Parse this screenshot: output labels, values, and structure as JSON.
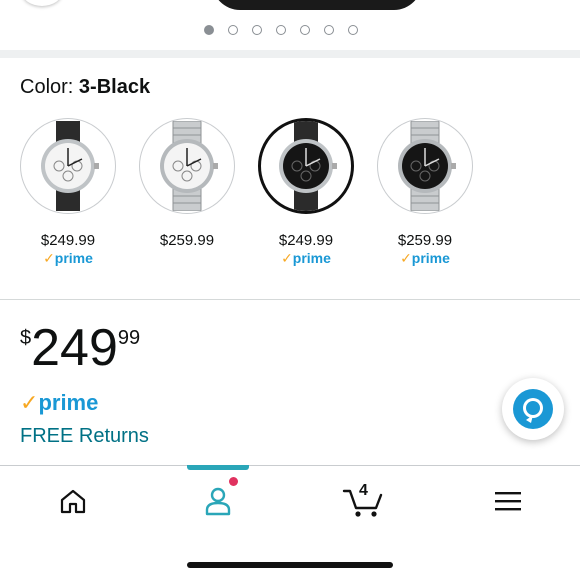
{
  "carousel": {
    "dot_count": 7,
    "active_index": 0
  },
  "color_section": {
    "label": "Color:",
    "selected": "3-Black"
  },
  "swatches": [
    {
      "price": "$249.99",
      "prime": "prime",
      "dial": "white",
      "band": "leather",
      "selected": false
    },
    {
      "price": "$259.99",
      "prime": "",
      "dial": "white",
      "band": "steel",
      "selected": false
    },
    {
      "price": "$249.99",
      "prime": "prime",
      "dial": "black",
      "band": "leather",
      "selected": true
    },
    {
      "price": "$259.99",
      "prime": "prime",
      "dial": "black",
      "band": "steel",
      "selected": false
    }
  ],
  "price": {
    "symbol": "$",
    "whole": "249",
    "fraction": "99"
  },
  "prime_badge": {
    "check": "✓",
    "text": "prime"
  },
  "free_returns": "FREE Returns",
  "nav": {
    "items": [
      "home-icon",
      "account-icon",
      "cart-icon",
      "menu-icon"
    ],
    "active": "account-icon",
    "cart_count": "4"
  },
  "colors": {
    "prime_blue": "#1a98d5",
    "prime_check": "#f7a823",
    "link_teal": "#007185",
    "indicator": "#2aa6b8",
    "badge": "#e0325f"
  }
}
